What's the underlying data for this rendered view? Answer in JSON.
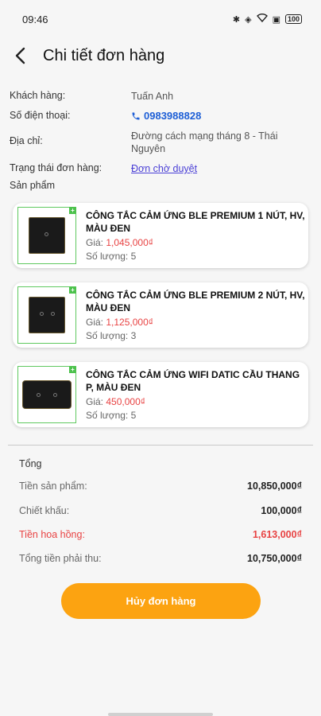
{
  "status_bar": {
    "time": "09:46",
    "battery": "100"
  },
  "header": {
    "title": "Chi tiết đơn hàng"
  },
  "order_info": {
    "customer_label": "Khách hàng:",
    "customer_value": "Tuấn Anh",
    "phone_label": "Số điện thoại:",
    "phone_value": "0983988828",
    "address_label": "Địa chỉ:",
    "address_value": "Đường cách mạng tháng 8 - Thái Nguyên",
    "status_label": "Trạng thái đơn hàng:",
    "status_value": "Đơn chờ duyệt"
  },
  "products_title": "Sản phẩm",
  "products": [
    {
      "name": "CÔNG TẮC CẢM ỨNG BLE PREMIUM 1 NÚT, HV, MÀU ĐEN",
      "price_label": "Giá:",
      "price": "1,045,000₫",
      "qty_label": "Số lượng:",
      "qty": "5",
      "badge": "+"
    },
    {
      "name": "CÔNG TẮC CẢM ỨNG BLE PREMIUM 2 NÚT, HV, MÀU ĐEN",
      "price_label": "Giá:",
      "price": "1,125,000₫",
      "qty_label": "Số lượng:",
      "qty": "3",
      "badge": "+"
    },
    {
      "name": "CÔNG TẮC CẢM ỨNG WIFI DATIC CẦU THANG P, MÀU ĐEN",
      "price_label": "Giá:",
      "price": "450,000₫",
      "qty_label": "Số lượng:",
      "qty": "5",
      "badge": "+"
    }
  ],
  "summary": {
    "title": "Tổng",
    "subtotal_label": "Tiền sản phẩm:",
    "subtotal_value": "10,850,000₫",
    "discount_label": "Chiết khấu:",
    "discount_value": "100,000₫",
    "commission_label": "Tiền hoa hồng:",
    "commission_value": "1,613,000₫",
    "total_label": "Tổng tiền phải thu:",
    "total_value": "10,750,000₫"
  },
  "actions": {
    "cancel_label": "Hủy đơn hàng"
  },
  "colors": {
    "accent": "#fca311",
    "price_red": "#e84343",
    "link_blue": "#1e5fd6",
    "status_purple": "#4a3fd6"
  }
}
